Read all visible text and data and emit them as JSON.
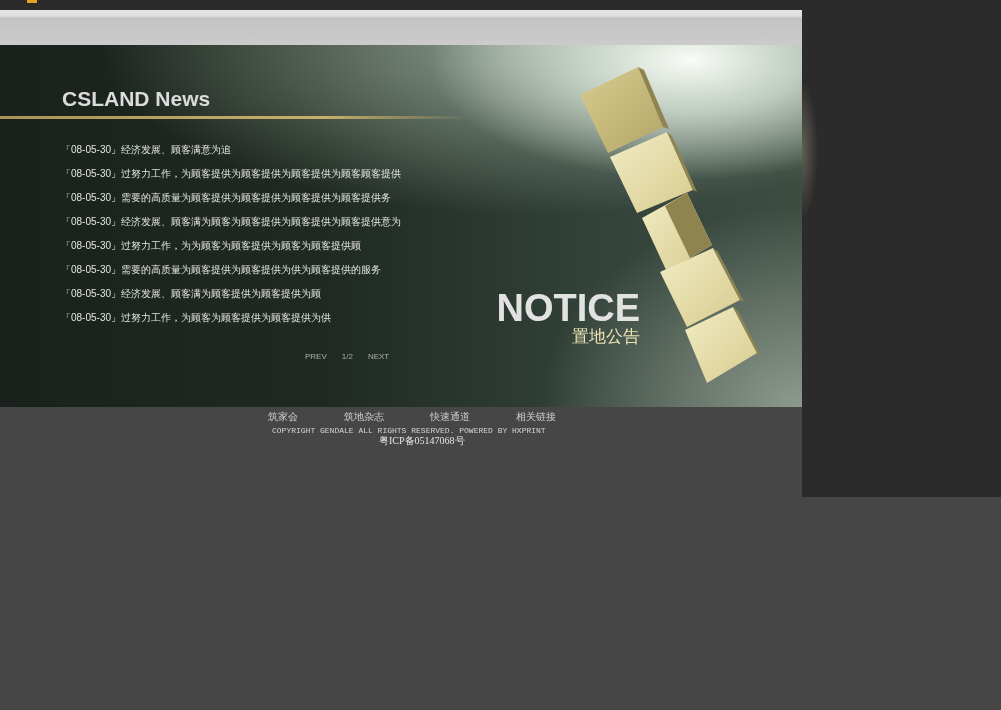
{
  "banner": {
    "title": "CSLAND News",
    "news": [
      {
        "date": "「08-05-30」",
        "title": "经济发展、顾客满意为追"
      },
      {
        "date": "「08-05-30」",
        "title": "过努力工作，为顾客提供为顾客提供为顾客提供为顾客顾客提供"
      },
      {
        "date": "「08-05-30」",
        "title": "需要的高质量为顾客提供为顾客提供为顾客提供为顾客提供务"
      },
      {
        "date": "「08-05-30」",
        "title": "经济发展、顾客满为顾客为顾客提供为顾客提供为顾客提供意为"
      },
      {
        "date": "「08-05-30」",
        "title": "过努力工作，为为顾客为顾客提供为顾客为顾客提供顾"
      },
      {
        "date": "「08-05-30」",
        "title": "需要的高质量为顾客提供为顾客提供为供为顾客提供的服务"
      },
      {
        "date": "「08-05-30」",
        "title": "经济发展、顾客满为顾客提供为顾客提供为顾"
      },
      {
        "date": "「08-05-30」",
        "title": "过努力工作，为顾客为顾客提供为顾客提供为供"
      }
    ],
    "pagination": {
      "prev": "PREV",
      "page": "1/2",
      "next": "NEXT"
    },
    "notice": {
      "heading": "NOTICE",
      "subheading": "置地公告"
    }
  },
  "footer": {
    "links": [
      "筑家会",
      "筑地杂志",
      "快速通道",
      "相关链接"
    ],
    "copyright": "COPYRIGHT GENDALE ALL RIGHTS RESERVED. POWERED BY HXPRINT",
    "icp": "粤ICP备05147068号"
  }
}
